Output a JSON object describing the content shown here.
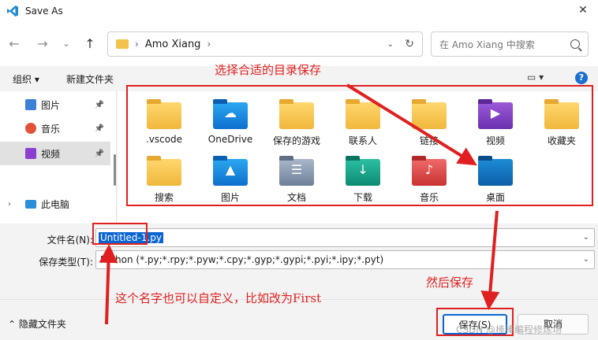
{
  "window": {
    "title": "Save As",
    "close_glyph": "✕",
    "app_icon": "vscode-icon"
  },
  "nav": {
    "back_glyph": "←",
    "forward_glyph": "→",
    "recent_glyph": "⌄",
    "up_glyph": "↑",
    "breadcrumb": "Amo Xiang",
    "breadcrumb_sep": "›",
    "breadcrumb_dd": "›",
    "refresh_glyph": "↻",
    "search_placeholder": "在 Amo Xiang 中搜索"
  },
  "toolbar": {
    "organize_label": "组织 ▾",
    "new_folder_label": "新建文件夹",
    "view_glyph": "▭ ▾",
    "help_glyph": "?"
  },
  "sidebar": {
    "items": [
      {
        "label": "图片",
        "icon": "pictures-icon",
        "color": "#3b82d6",
        "pinned": true,
        "selected": false
      },
      {
        "label": "音乐",
        "icon": "music-icon",
        "color": "#e0533a",
        "pinned": true,
        "selected": false
      },
      {
        "label": "视频",
        "icon": "video-icon",
        "color": "#8b3fd1",
        "pinned": true,
        "selected": true
      },
      {
        "label": "此电脑",
        "icon": "computer-icon",
        "color": "#2a8fd8",
        "pinned": false,
        "selected": false
      }
    ],
    "pin_glyph": "📌",
    "expand_glyph": "›"
  },
  "files": [
    {
      "name": ".vscode",
      "style": "yellow",
      "glyph": ""
    },
    {
      "name": "OneDrive",
      "style": "blue",
      "glyph": "☁"
    },
    {
      "name": "保存的游戏",
      "style": "yellow",
      "glyph": ""
    },
    {
      "name": "联系人",
      "style": "yellow",
      "glyph": ""
    },
    {
      "name": "链接",
      "style": "yellow",
      "glyph": ""
    },
    {
      "name": "视频",
      "style": "purple",
      "glyph": "▶"
    },
    {
      "name": "收藏夹",
      "style": "yellow",
      "glyph": ""
    },
    {
      "name": "搜索",
      "style": "yellow",
      "glyph": ""
    },
    {
      "name": "图片",
      "style": "blue",
      "glyph": "▲"
    },
    {
      "name": "文档",
      "style": "gray",
      "glyph": "☰"
    },
    {
      "name": "下载",
      "style": "teal",
      "glyph": "↓"
    },
    {
      "name": "音乐",
      "style": "red",
      "glyph": "♪"
    },
    {
      "name": "桌面",
      "style": "dark",
      "glyph": ""
    }
  ],
  "form": {
    "filename_label": "文件名(N):",
    "filename_value": "Untitled-1.py",
    "filetype_label": "保存类型(T):",
    "filetype_value": "Python (*.py;*.rpy;*.pyw;*.cpy;*.gyp;*.gypi;*.pyi;*.ipy;*.pyt)",
    "dropdown_glyph": "⌄"
  },
  "footer": {
    "hide_folders_label": "⌃  隐藏文件夹",
    "save_label": "保存(S)",
    "cancel_label": "取消"
  },
  "annotations": {
    "choose_dir": "选择合适的目录保存",
    "then_save": "然后保存",
    "rename_hint": "这个名字也可以自定义，比如改为First",
    "color": "#e02020"
  },
  "watermark": "CSDN @棒棒编程修炼场"
}
